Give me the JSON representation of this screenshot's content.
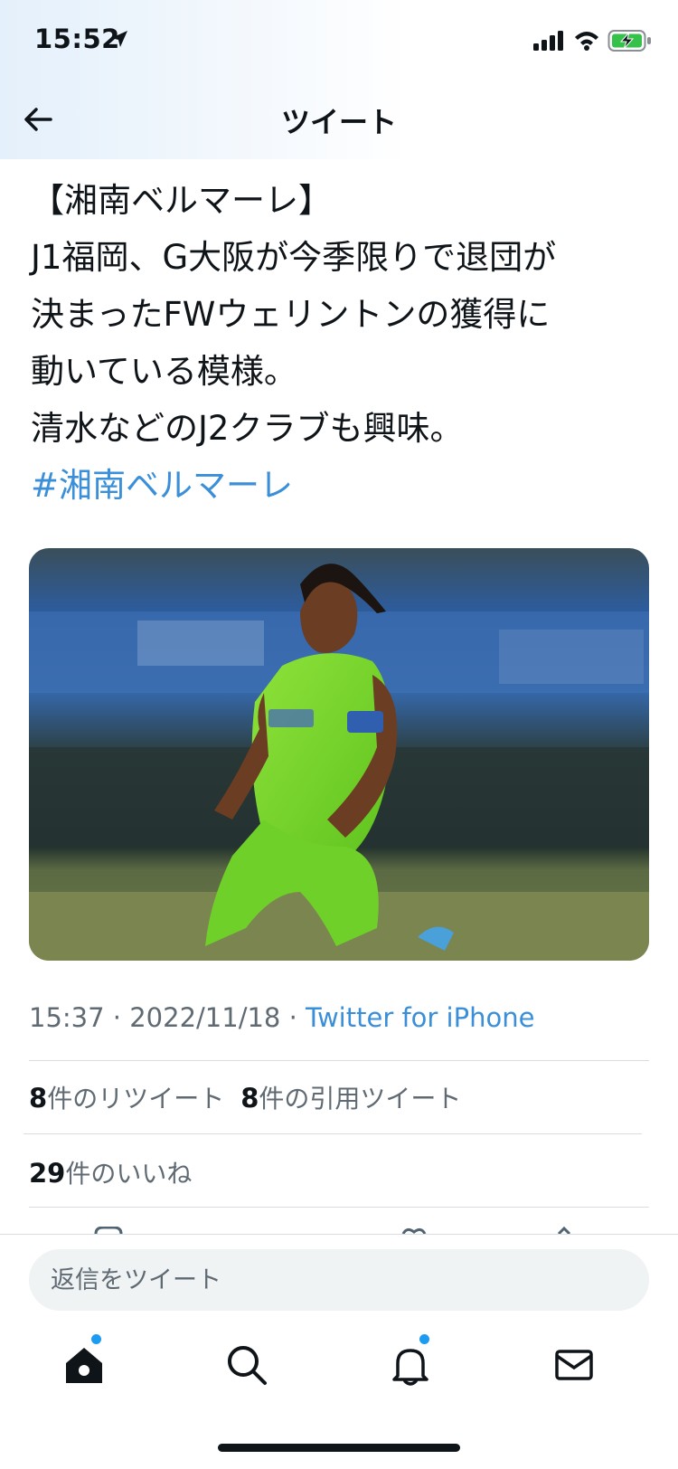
{
  "status_bar": {
    "time": "15:52"
  },
  "nav": {
    "title": "ツイート"
  },
  "tweet": {
    "lines": [
      "【湘南ベルマーレ】",
      "J1福岡、G大阪が今季限りで退団が",
      "決まったFWウェリントンの獲得に",
      "動いている模様。",
      "清水などのJ2クラブも興味。"
    ],
    "hashtag": "#湘南ベルマーレ",
    "media": {
      "description_icon": "photo"
    },
    "time": "15:37",
    "separator": " · ",
    "date": "2022/11/18",
    "client": "Twitter for iPhone"
  },
  "stats": {
    "retweets": {
      "count": "8",
      "label": "件のリツイート"
    },
    "quotes": {
      "count": "8",
      "label": "件の引用ツイート"
    },
    "likes": {
      "count": "29",
      "label": "件のいいね"
    }
  },
  "reply": {
    "placeholder": "返信をツイート"
  },
  "tab_bar": {
    "items": [
      "home",
      "search",
      "notifications",
      "messages"
    ],
    "badge_color": "#1d9bf0"
  },
  "colors": {
    "link": "#3a8fd8",
    "text": "#0f1419",
    "muted": "#606a73"
  }
}
